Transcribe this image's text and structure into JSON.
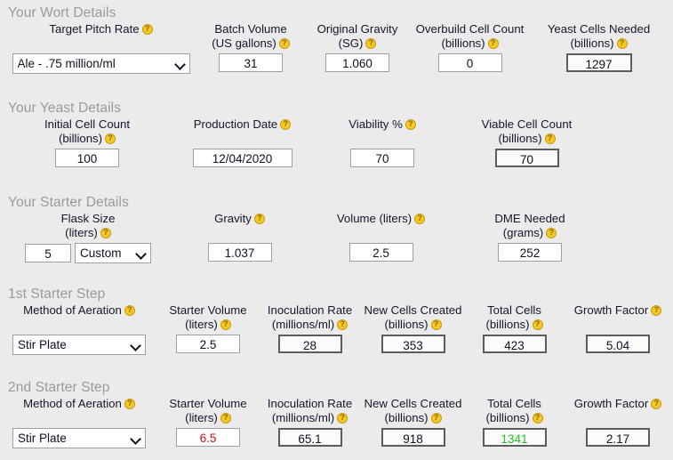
{
  "colors": {
    "background": "#ebebeb",
    "heading": "#9a9a9a",
    "label": "#15162b",
    "help_icon": "#f7c824",
    "readonly_border": "#5c5c5c",
    "value_red": "#d11010",
    "value_green": "#1fc21f"
  },
  "sections": {
    "wort": {
      "heading": "Your Wort Details",
      "fields": {
        "target_pitch_rate": {
          "label_line1": "Target Pitch Rate",
          "value": "Ale - .75 million/ml"
        },
        "batch_volume": {
          "label_line1": "Batch Volume",
          "label_line2": "(US gallons)",
          "value": "31"
        },
        "original_gravity": {
          "label_line1": "Original Gravity",
          "label_line2": "(SG)",
          "value": "1.060"
        },
        "overbuild_cell_count": {
          "label_line1": "Overbuild Cell Count",
          "label_line2": "(billions)",
          "value": "0"
        },
        "yeast_cells_needed": {
          "label_line1": "Yeast Cells Needed",
          "label_line2": "(billions)",
          "value": "1297"
        }
      }
    },
    "yeast": {
      "heading": "Your Yeast Details",
      "fields": {
        "initial_cell_count": {
          "label_line1": "Initial Cell Count",
          "label_line2": "(billions)",
          "value": "100"
        },
        "production_date": {
          "label_line1": "Production Date",
          "value": "12/04/2020"
        },
        "viability": {
          "label_line1": "Viability %",
          "value": "70"
        },
        "viable_cell_count": {
          "label_line1": "Viable Cell Count",
          "label_line2": "(billions)",
          "value": "70"
        }
      }
    },
    "starter": {
      "heading": "Your Starter Details",
      "fields": {
        "flask_size": {
          "label_line1": "Flask Size",
          "label_line2": "(liters)",
          "value": "5",
          "preset": "Custom"
        },
        "gravity": {
          "label_line1": "Gravity",
          "value": "1.037"
        },
        "volume": {
          "label_line1": "Volume (liters)",
          "value": "2.5"
        },
        "dme_needed": {
          "label_line1": "DME Needed",
          "label_line2": "(grams)",
          "value": "252"
        }
      }
    },
    "step1": {
      "heading": "1st Starter Step",
      "fields": {
        "method_of_aeration": {
          "label_line1": "Method of Aeration",
          "value": "Stir Plate"
        },
        "starter_volume": {
          "label_line1": "Starter Volume",
          "label_line2": "(liters)",
          "value": "2.5"
        },
        "inoculation_rate": {
          "label_line1": "Inoculation Rate",
          "label_line2": "(millions/ml)",
          "value": "28"
        },
        "new_cells_created": {
          "label_line1": "New Cells Created",
          "label_line2": "(billions)",
          "value": "353"
        },
        "total_cells": {
          "label_line1": "Total Cells",
          "label_line2": "(billions)",
          "value": "423"
        },
        "growth_factor": {
          "label_line1": "Growth Factor",
          "value": "5.04"
        }
      }
    },
    "step2": {
      "heading": "2nd Starter Step",
      "fields": {
        "method_of_aeration": {
          "label_line1": "Method of Aeration",
          "value": "Stir Plate"
        },
        "starter_volume": {
          "label_line1": "Starter Volume",
          "label_line2": "(liters)",
          "value": "6.5"
        },
        "inoculation_rate": {
          "label_line1": "Inoculation Rate",
          "label_line2": "(millions/ml)",
          "value": "65.1"
        },
        "new_cells_created": {
          "label_line1": "New Cells Created",
          "label_line2": "(billions)",
          "value": "918"
        },
        "total_cells": {
          "label_line1": "Total Cells",
          "label_line2": "(billions)",
          "value": "1341"
        },
        "growth_factor": {
          "label_line1": "Growth Factor",
          "value": "2.17"
        }
      }
    }
  }
}
